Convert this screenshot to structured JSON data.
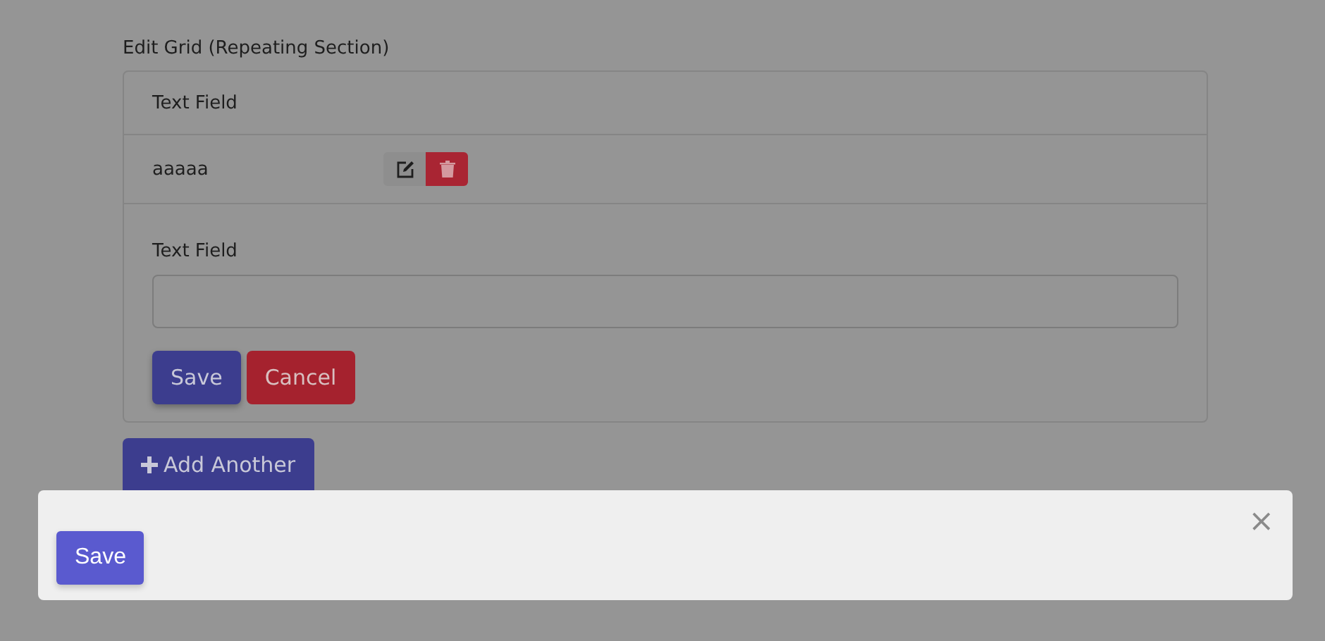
{
  "edit_grid": {
    "label": "Edit Grid (Repeating Section)",
    "header": "Text Field",
    "rows": [
      {
        "value": "aaaaa"
      }
    ],
    "editor": {
      "label": "Text Field",
      "save": "Save",
      "cancel": "Cancel"
    },
    "add_button": "Add Another"
  },
  "dialog": {
    "close": "×",
    "save": "Save"
  }
}
